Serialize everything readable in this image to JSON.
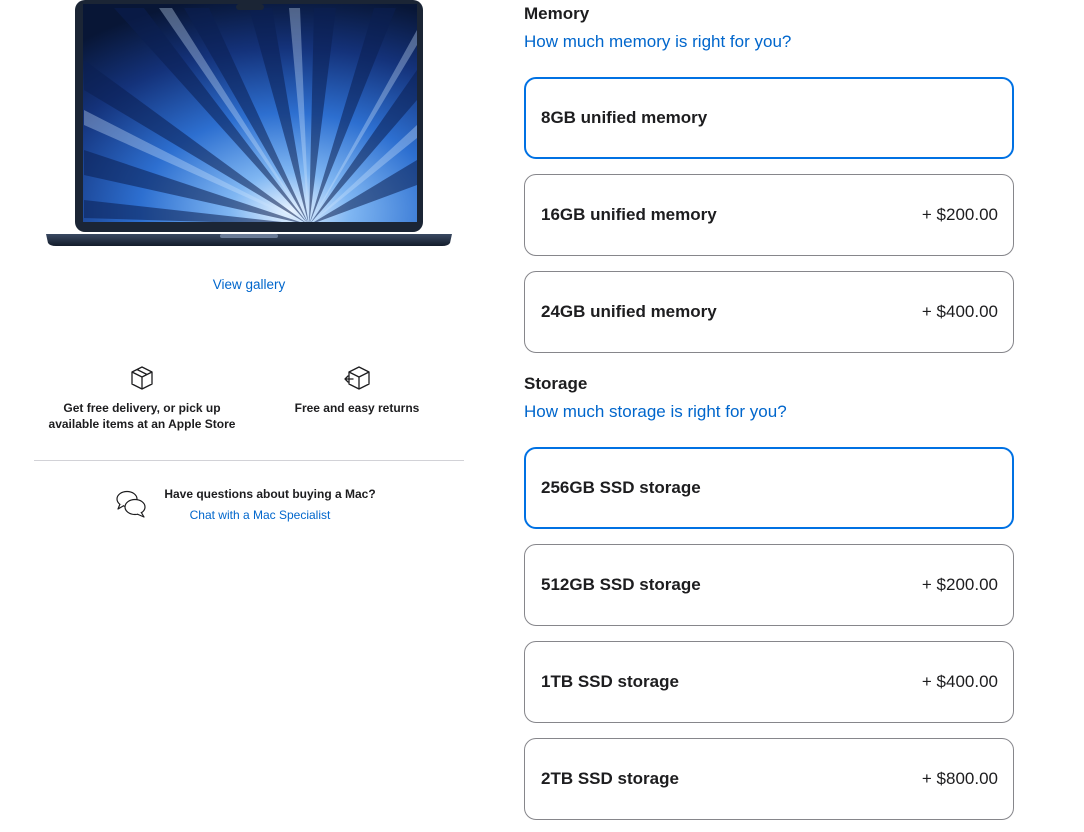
{
  "left": {
    "gallery_link": "View gallery",
    "services": [
      {
        "icon": "box-icon",
        "text": "Get free delivery, or pick up available items at an Apple Store"
      },
      {
        "icon": "return-box-icon",
        "text": "Free and easy returns"
      }
    ],
    "chat": {
      "question": "Have questions about buying a Mac?",
      "link": "Chat with a Mac Specialist"
    }
  },
  "memory": {
    "title": "Memory",
    "help_link": "How much memory is right for you?",
    "options": [
      {
        "label": "8GB unified memory",
        "price": "",
        "selected": true
      },
      {
        "label": "16GB unified memory",
        "price": "+ $200.00",
        "selected": false
      },
      {
        "label": "24GB unified memory",
        "price": "+ $400.00",
        "selected": false
      }
    ]
  },
  "storage": {
    "title": "Storage",
    "help_link": "How much storage is right for you?",
    "options": [
      {
        "label": "256GB SSD storage",
        "price": "",
        "selected": true
      },
      {
        "label": "512GB SSD storage",
        "price": "+ $200.00",
        "selected": false
      },
      {
        "label": "1TB SSD storage",
        "price": "+ $400.00",
        "selected": false
      },
      {
        "label": "2TB SSD storage",
        "price": "+ $800.00",
        "selected": false
      }
    ]
  },
  "colors": {
    "accent": "#0071e3",
    "link": "#0066cc",
    "text": "#1d1d1f",
    "border": "#86868b"
  }
}
